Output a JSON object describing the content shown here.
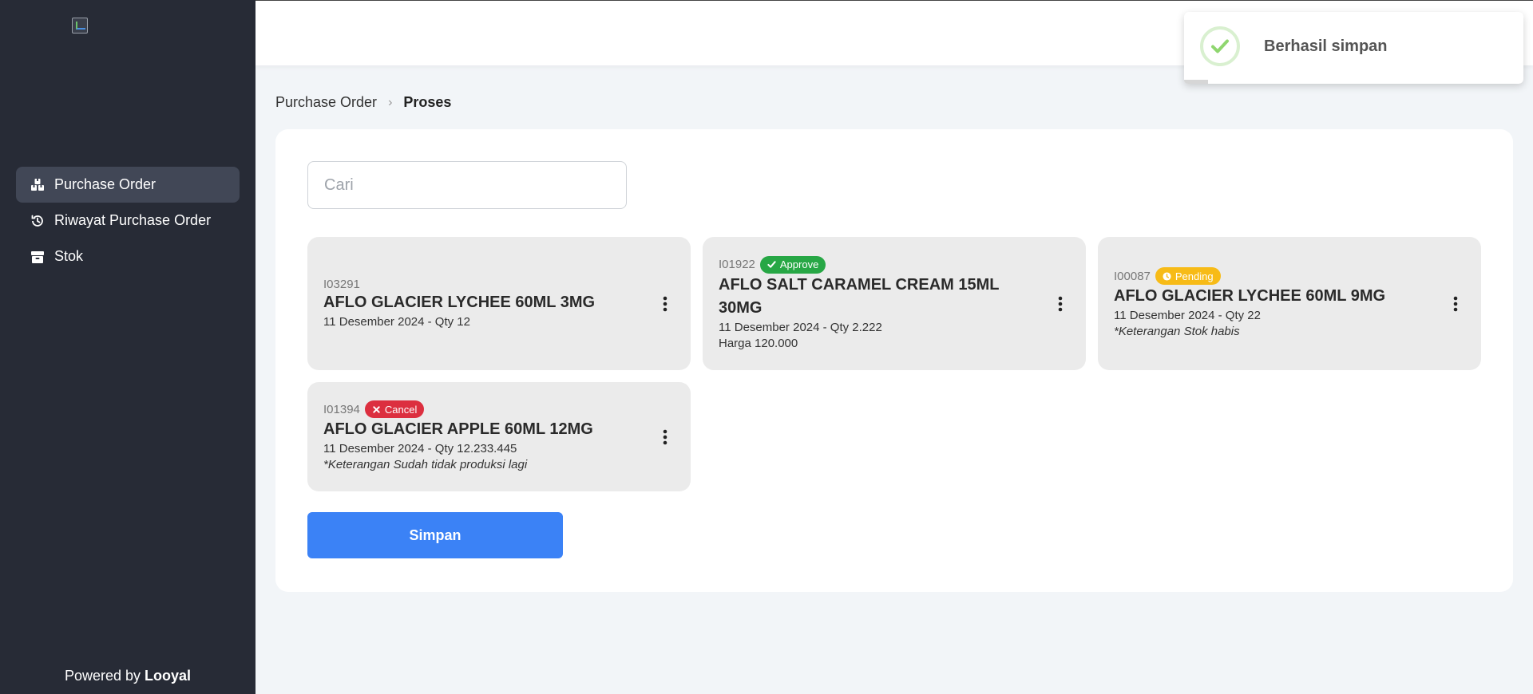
{
  "sidebar": {
    "nav": [
      {
        "label": "Purchase Order",
        "icon": "boxes-icon",
        "active": true
      },
      {
        "label": "Riwayat Purchase Order",
        "icon": "history-icon",
        "active": false
      },
      {
        "label": "Stok",
        "icon": "box-icon",
        "active": false
      }
    ],
    "powered_prefix": "Powered by",
    "powered_brand": "Looyal"
  },
  "breadcrumb": {
    "parent": "Purchase Order",
    "current": "Proses"
  },
  "search": {
    "placeholder": "Cari",
    "value": ""
  },
  "cards": [
    {
      "code": "I03291",
      "title": "AFLO GLACIER LYCHEE 60ML 3MG",
      "sub": "11 Desember 2024 - Qty 12"
    },
    {
      "code": "I01922",
      "status": "Approve",
      "title": "AFLO SALT CARAMEL CREAM 15ML 30MG",
      "sub": "11 Desember 2024 - Qty 2.222",
      "extra": "Harga 120.000"
    },
    {
      "code": "I00087",
      "status": "Pending",
      "title": "AFLO GLACIER LYCHEE 60ML 9MG",
      "sub": "11 Desember 2024 - Qty 22",
      "note": "*Keterangan Stok habis"
    },
    {
      "code": "I01394",
      "status": "Cancel",
      "title": "AFLO GLACIER APPLE 60ML 12MG",
      "sub": "11 Desember 2024 - Qty 12.233.445",
      "note": "*Keterangan Sudah tidak produksi lagi"
    }
  ],
  "save_button": {
    "label": "Simpan"
  },
  "toast": {
    "message": "Berhasil simpan",
    "icon": "check-icon",
    "progress": 0.07
  },
  "colors": {
    "sidebar": "#272b36",
    "primary": "#3b82f6",
    "approve": "#27a745",
    "pending": "#f7bb17",
    "cancel": "#dc2f3f"
  }
}
